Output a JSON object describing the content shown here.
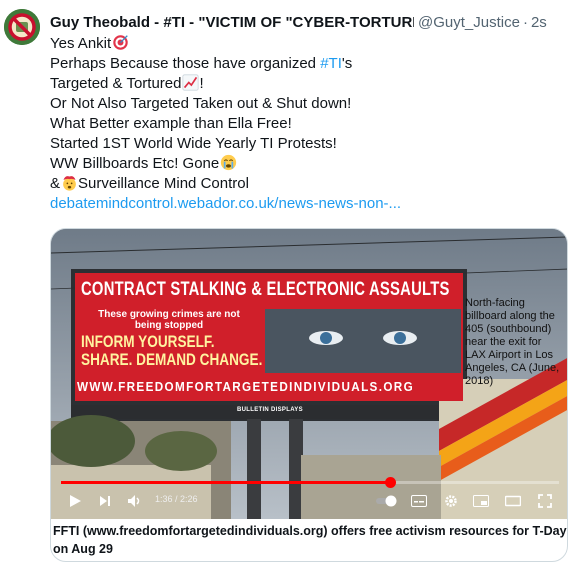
{
  "tweet": {
    "display_name": "Guy Theobald - #TI - \"VICTIM OF \"CYBER-TORTURE",
    "handle": "@Guyt_Justice",
    "separator": "·",
    "time": "2s",
    "lines": [
      {
        "text": "Yes Ankit",
        "emoji": "bullseye"
      },
      {
        "before": "Perhaps Because those have organized ",
        "hashtag": "#TI",
        "after": "'s"
      },
      {
        "text": "Targeted & Tortured",
        "emoji": "chart-increasing",
        "after": "!"
      },
      {
        "text": "Or Not Also Targeted Taken out & Shut down!"
      },
      {
        "text": "What Better example than Ella Free!"
      },
      {
        "text": "Started 1ST World Wide Yearly TI Protests!"
      },
      {
        "text": "WW Billboards Etc! Gone",
        "emoji": "crying-face"
      },
      {
        "before": "&",
        "emoji": "exploding-head",
        "text": "Surveillance Mind Control"
      }
    ],
    "link": "debatemindcontrol.webador.co.uk/news-news-non-..."
  },
  "media": {
    "billboard": {
      "title": "CONTRACT STALKING & ELECTRONIC ASSAULTS",
      "subtitle": "These growing crimes are not being stopped",
      "cta_line1": "INFORM YOURSELF.",
      "cta_line2": "SHARE. DEMAND CHANGE.",
      "url": "WWW.FREEDOMFORTARGETEDINDIVIDUALS.ORG",
      "vendor": "BULLETIN DISPLAYS"
    },
    "caption": "North-facing billboard along the 405 (southbound) near the exit for LAX Airport in Los Angeles, CA (June, 2018)",
    "player": {
      "current_time": "1:36",
      "duration": "2:26",
      "time_display": "1:36 / 2:26",
      "progress_fraction": 0.66
    },
    "card_title": "FFTI (www.freedomfortargetedindividuals.org) offers free activism resources for T-Day on Aug 29"
  },
  "colors": {
    "link": "#1d9bf0",
    "text": "#0f1419",
    "muted": "#536471",
    "progress": "#ff0000",
    "billboard_red": "#d01f2a"
  },
  "icons": {
    "avatar": "no-symbol-avatar",
    "play": "play-icon",
    "next": "next-icon",
    "volume": "volume-icon",
    "autoplay": "autoplay-toggle-icon",
    "subtitles": "subtitles-icon",
    "settings": "gear-icon",
    "miniplayer": "miniplayer-icon",
    "theater": "theater-icon",
    "fullscreen": "fullscreen-icon"
  }
}
